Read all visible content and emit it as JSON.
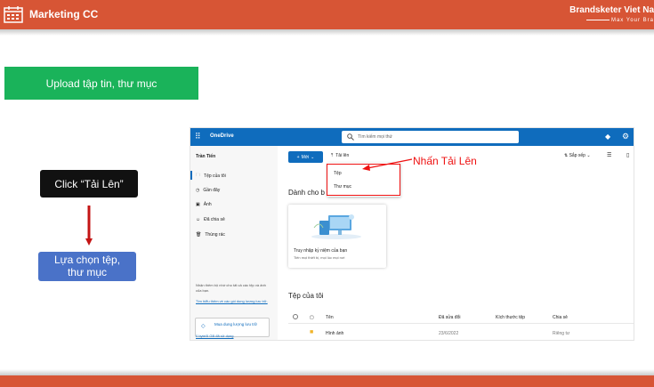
{
  "header": {
    "title": "Marketing CC",
    "brand": "Brandsketer Viet Na",
    "slogan": "Max Your Bra"
  },
  "steps": {
    "step1": "Upload tập tin, thư mục",
    "step2": "Click “Tải Lên”",
    "step3_line1": "Lựa chọn tệp,",
    "step3_line2": "thư mục"
  },
  "onedrive": {
    "app_name": "OneDrive",
    "search_placeholder": "Tìm kiếm mọi thứ",
    "sidebar": {
      "user": "Trần Tiến",
      "items": [
        {
          "label": "Tệp của tôi",
          "icon": "folder-icon"
        },
        {
          "label": "Gần đây",
          "icon": "clock-icon"
        },
        {
          "label": "Ảnh",
          "icon": "photo-icon"
        },
        {
          "label": "Đã chia sẻ",
          "icon": "people-icon"
        },
        {
          "label": "Thùng rác",
          "icon": "trash-icon"
        }
      ],
      "note": "Nhận thêm bộ nhớ cho tất cả các tệp và ảnh của bạn.",
      "note_link": "Tìm hiểu thêm về các gói dung lượng lưu trữ.",
      "buy_label": "Mua dung lượng lưu trữ",
      "storage": "0 byte/5 GB đã sử dụng"
    },
    "toolbar": {
      "new_label": "Mới",
      "upload_label": "Tải lên",
      "sort_label": "Sắp xếp"
    },
    "upload_menu": {
      "file": "Tệp",
      "folder": "Thư mục"
    },
    "callout": "Nhấn Tải Lên",
    "for_you": {
      "heading": "Dành cho b",
      "card_title": "Truy nhập kỷ niệm của bạn",
      "card_sub": "Tiến mọi thiết bị, mọi lúc mọi nơi"
    },
    "files": {
      "heading": "Tệp của tôi",
      "columns": [
        "Tên",
        "Đã sửa đổi",
        "Kích thước tệp",
        "Chia sẻ"
      ],
      "rows": [
        {
          "name": "Hình ảnh",
          "modified": "23/6/2022",
          "size": "",
          "sharing": "Riêng tư"
        }
      ]
    }
  },
  "colors": {
    "topbar": "#d75535",
    "green": "#1ab35a",
    "blue": "#4a72c8",
    "onedrive_blue": "#0f6cbd",
    "callout_red": "#e11"
  }
}
